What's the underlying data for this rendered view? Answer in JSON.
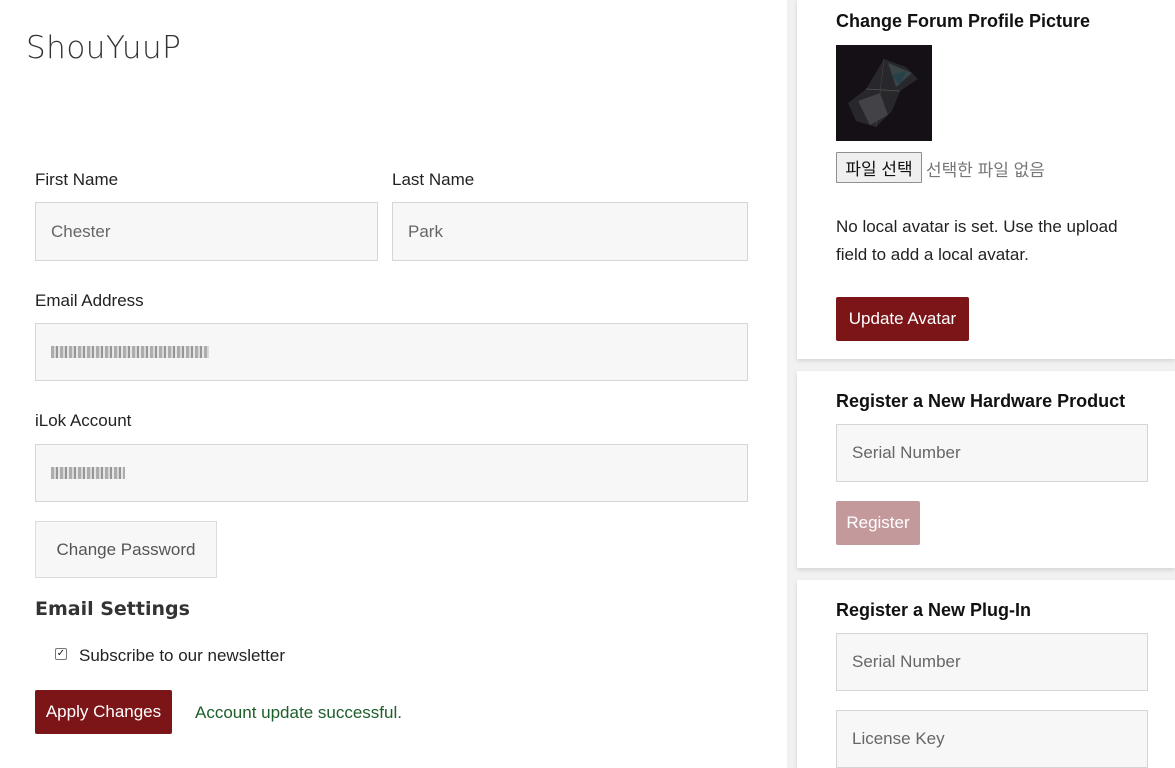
{
  "profile": {
    "username": "ShouYuuP",
    "first_name_label": "First Name",
    "first_name_value": "Chester",
    "last_name_label": "Last Name",
    "last_name_value": "Park",
    "email_label": "Email Address",
    "ilok_label": "iLok Account",
    "change_password_label": "Change Password"
  },
  "email_settings": {
    "title": "Email Settings",
    "newsletter_label": "Subscribe to our newsletter",
    "newsletter_checked": true,
    "apply_label": "Apply Changes",
    "status_message": "Account update successful."
  },
  "avatar_card": {
    "title": "Change Forum Profile Picture",
    "file_button_label": "파일 선택",
    "file_status": "선택한 파일 없음",
    "info_line1": "No local avatar is set. Use the upload",
    "info_line2": "field to add a local avatar.",
    "update_label": "Update Avatar"
  },
  "hardware_card": {
    "title": "Register a New Hardware Product",
    "serial_placeholder": "Serial Number",
    "register_label": "Register"
  },
  "plugin_card": {
    "title": "Register a New Plug-In",
    "serial_placeholder": "Serial Number",
    "license_placeholder": "License Key"
  },
  "colors": {
    "primary": "#7c1518",
    "primary_disabled": "#c4999b",
    "success": "#1d5e2a"
  }
}
